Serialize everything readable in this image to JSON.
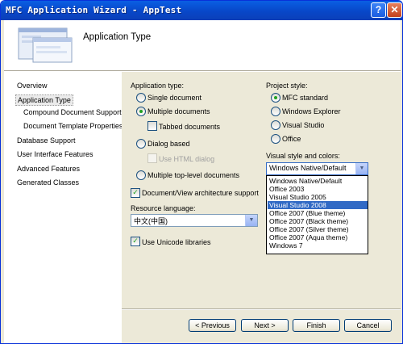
{
  "window": {
    "title": "MFC Application Wizard - AppTest",
    "help_icon": "?",
    "close_icon": "✕"
  },
  "header": {
    "title": "Application Type"
  },
  "nav": {
    "items": [
      {
        "label": "Overview"
      },
      {
        "label": "Application Type"
      },
      {
        "label": "Compound Document Support"
      },
      {
        "label": "Document Template Properties"
      },
      {
        "label": "Database Support"
      },
      {
        "label": "User Interface Features"
      },
      {
        "label": "Advanced Features"
      },
      {
        "label": "Generated Classes"
      }
    ],
    "selected": "Application Type"
  },
  "app_type": {
    "label": "Application type:",
    "options": [
      "Single document",
      "Multiple documents",
      "Tabbed documents",
      "Dialog based",
      "Use HTML dialog",
      "Multiple top-level documents"
    ],
    "selected": "Multiple documents",
    "tabbed_checked": false,
    "html_dialog_checked": false
  },
  "doc_view": {
    "label": "Document/View architecture support",
    "checked": true
  },
  "resource": {
    "label": "Resource language:",
    "value": "中文(中国)"
  },
  "unicode": {
    "label": "Use Unicode libraries",
    "checked": true
  },
  "project_style": {
    "label": "Project style:",
    "options": [
      "MFC standard",
      "Windows Explorer",
      "Visual Studio",
      "Office"
    ],
    "selected": "MFC standard"
  },
  "visual_style": {
    "label": "Visual style and colors:",
    "value": "Windows Native/Default",
    "options": [
      "Windows Native/Default",
      "Office 2003",
      "Visual Studio 2005",
      "Visual Studio 2008",
      "Office 2007 (Blue theme)",
      "Office 2007 (Black theme)",
      "Office 2007 (Silver theme)",
      "Office 2007 (Aqua theme)",
      "Windows 7"
    ],
    "highlighted": "Visual Studio 2008"
  },
  "buttons": {
    "previous": "< Previous",
    "next": "Next >",
    "finish": "Finish",
    "cancel": "Cancel"
  },
  "colors": {
    "titlebar": "#0a5fe3",
    "highlight": "#316ac5",
    "dialog_bg": "#ece9d8"
  }
}
